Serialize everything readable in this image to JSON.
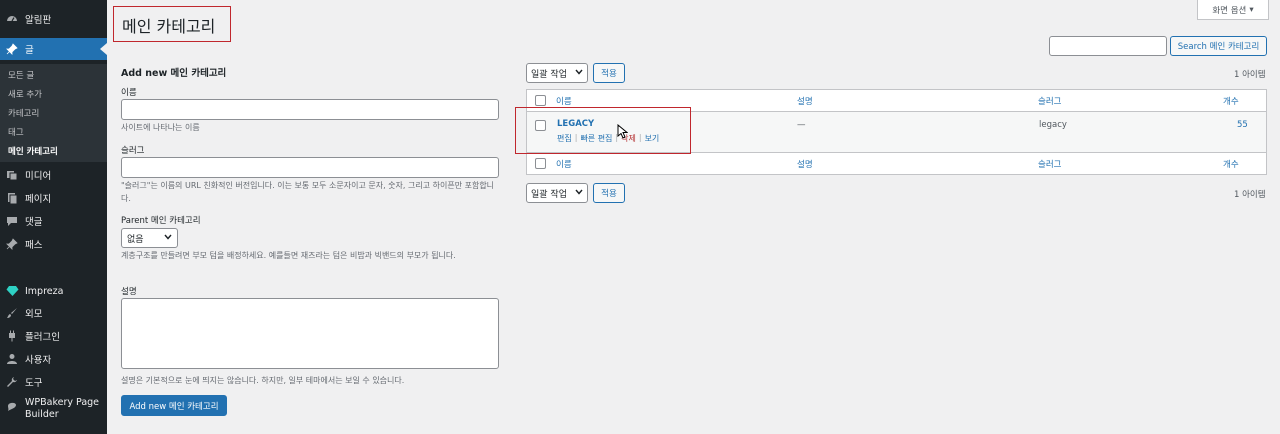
{
  "sidebar": {
    "items": [
      {
        "label": "알림판",
        "icon": "dashboard-icon"
      },
      {
        "label": "글",
        "icon": "pushpin-icon",
        "active": true
      },
      {
        "label": "미디어",
        "icon": "media-icon"
      },
      {
        "label": "페이지",
        "icon": "page-icon"
      },
      {
        "label": "댓글",
        "icon": "comment-icon"
      },
      {
        "label": "패스",
        "icon": "pushpin-icon"
      },
      {
        "label": "Impreza",
        "icon": "diamond-icon"
      },
      {
        "label": "외모",
        "icon": "brush-icon"
      },
      {
        "label": "플러그인",
        "icon": "plugin-icon"
      },
      {
        "label": "사용자",
        "icon": "user-icon"
      },
      {
        "label": "도구",
        "icon": "wrench-icon"
      },
      {
        "label": "WPBakery Page Builder",
        "icon": "wpbakery-icon"
      }
    ],
    "submenu": [
      "모든 글",
      "새로 추가",
      "카테고리",
      "태그",
      "메인 카테고리"
    ]
  },
  "header": {
    "title": "메인 카테고리",
    "screen_options": "화면 옵션"
  },
  "search": {
    "placeholder": "",
    "button": "Search 메인 카테고리"
  },
  "form": {
    "heading": "Add new 메인 카테고리",
    "name_label": "이름",
    "name_desc": "사이트에 나타나는 이름",
    "slug_label": "슬러그",
    "slug_desc": "\"슬러그\"는 이름의 URL 친화적인 버전입니다. 이는 보통 모두 소문자이고 문자, 숫자, 그리고 하이픈만 포함합니다.",
    "parent_label": "Parent 메인 카테고리",
    "parent_value": "없음",
    "parent_desc": "계층구조를 만들려면 부모 텀을 배정하세요. 예를들면 재즈라는 텀은 비밥과 빅밴드의 부모가 됩니다.",
    "description_label": "설명",
    "description_desc": "설명은 기본적으로 눈에 띄지는 않습니다. 하지만, 일부 테마에서는 보일 수 있습니다.",
    "submit": "Add new 메인 카테고리"
  },
  "list": {
    "bulk_action": "일괄 작업",
    "apply": "적용",
    "count": "1 아이템",
    "columns": [
      "이름",
      "설명",
      "슬러그",
      "개수"
    ],
    "rows": [
      {
        "name": "LEGACY",
        "description": "—",
        "slug": "legacy",
        "count": "55",
        "actions": [
          "편집",
          "빠른 편집",
          "삭제",
          "보기"
        ]
      }
    ]
  },
  "colors": {
    "accent": "#2271b1",
    "sidebar_bg": "#1d2327",
    "annotation_red": "#c0272d",
    "delete_red": "#b32d2e"
  }
}
